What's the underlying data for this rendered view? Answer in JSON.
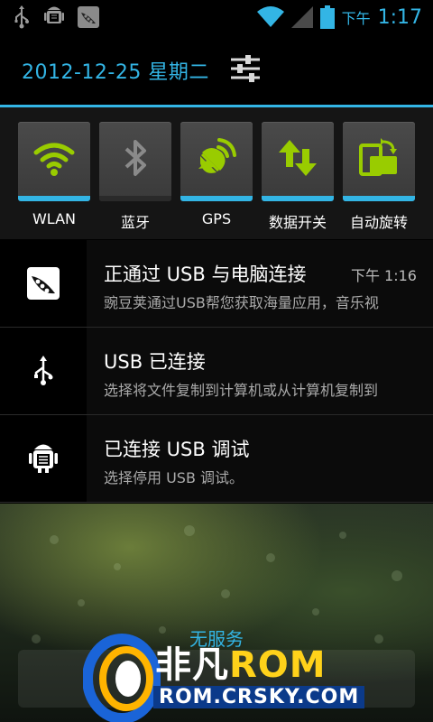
{
  "status_bar": {
    "icons_left": [
      "usb-icon",
      "android-debug-icon",
      "peapod-icon"
    ],
    "icons_right": [
      "wifi-icon",
      "signal-icon",
      "battery-icon"
    ],
    "ampm": "下午",
    "time": "1:17"
  },
  "header": {
    "date": "2012-12-25 星期二",
    "settings_icon": "settings-sliders-icon"
  },
  "toggles": [
    {
      "label": "WLAN",
      "icon": "wifi-icon",
      "on": true
    },
    {
      "label": "蓝牙",
      "icon": "bluetooth-icon",
      "on": false
    },
    {
      "label": "GPS",
      "icon": "gps-icon",
      "on": true
    },
    {
      "label": "数据开关",
      "icon": "data-arrows-icon",
      "on": true
    },
    {
      "label": "自动旋转",
      "icon": "auto-rotate-icon",
      "on": true
    }
  ],
  "notifications": [
    {
      "title": "正通过 USB 与电脑连接",
      "time": "下午 1:16",
      "text": "豌豆荚通过USB帮您获取海量应用，音乐视",
      "icon": "peapod-icon"
    },
    {
      "title": "USB 已连接",
      "time": "",
      "text": "选择将文件复制到计算机或从计算机复制到",
      "icon": "usb-icon"
    },
    {
      "title": "已连接 USB 调试",
      "time": "",
      "text": "选择停用 USB 调试。",
      "icon": "android-debug-icon"
    }
  ],
  "bottom": {
    "no_service": "无服务"
  },
  "watermark": {
    "brand_cn": "非凡",
    "brand_rom": "ROM",
    "url": "ROM.CRSKY.COM"
  },
  "colors": {
    "accent": "#33b5e5",
    "toggle_on_icon": "#99cc00",
    "toggle_off_icon": "#8a8a8a"
  }
}
